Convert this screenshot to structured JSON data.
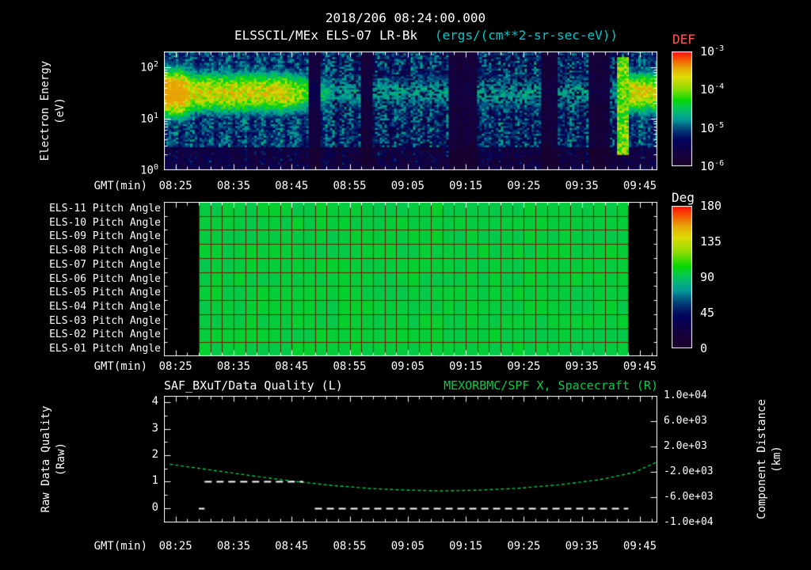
{
  "header": {
    "timestamp": "2018/206 08:24:00.000",
    "instrument": "ELSSCIL/MEx ELS-07 LR-Bk",
    "units": "(ergs/(cm**2-sr-sec-eV))"
  },
  "colors": {
    "background": "#000000",
    "text": "#ffffff",
    "units_text": "#00c8c8",
    "def_label": "#ff5555",
    "right_title": "#00cc44",
    "pitch_grid": "#6b1e00"
  },
  "time_axis": {
    "start": "08:23",
    "end": "09:48",
    "tick_interval_min": 10,
    "minor_tick_min": 2
  },
  "chart_data": [
    {
      "type": "heatmap",
      "role": "electron-energy-spectrogram",
      "title": "ELSSCIL/MEx ELS-07 LR-Bk",
      "units": "(ergs/(cm**2-sr-sec-eV))",
      "xlabel": "GMT(min)",
      "x_ticks": [
        "08:25",
        "08:35",
        "08:45",
        "08:55",
        "09:05",
        "09:15",
        "09:25",
        "09:35",
        "09:45"
      ],
      "ylabel_line1": "Electron Energy",
      "ylabel_line2": "(eV)",
      "y_scale": "log",
      "y_min_ev": 1,
      "y_max_ev": 200,
      "y_ticks": [
        "10^2",
        "10^1",
        "10^0"
      ],
      "colorbar": {
        "label": "DEF",
        "scale": "log",
        "ticks": [
          "10^-3",
          "10^-4",
          "10^-5",
          "10^-6"
        ]
      },
      "features": {
        "background_level": 0.3,
        "noise_amplitude": 0.22,
        "low_energy_cutoff_logE": 0.45,
        "main_band": {
          "center_logE": 1.5,
          "sigma_logE": 0.34,
          "peak": 0.8,
          "fade_start": "08:44",
          "fade_end": "08:52",
          "faint_level": 0.42
        },
        "hotspot": {
          "end": "08:26",
          "extra": 0.25,
          "center_logE": 1.45,
          "sigma_logE": 0.6
        },
        "dark_columns": [
          [
            "08:48",
            "08:50"
          ],
          [
            "08:57",
            "08:59"
          ],
          [
            "09:12",
            "09:17"
          ],
          [
            "09:28",
            "09:31"
          ],
          [
            "09:36",
            "09:40"
          ]
        ],
        "speckle_dark_start": "08:52",
        "speckle_dark_fraction": 0.2,
        "bright_column": {
          "start": "09:41",
          "end": "09:43",
          "level": 0.66,
          "logE_min": 0.3,
          "logE_max": 2.2
        },
        "right_band": {
          "start": "09:43",
          "peak": 0.8
        }
      }
    },
    {
      "type": "heatmap",
      "role": "pitch-angle-panel",
      "rows": [
        "ELS-11 Pitch Angle",
        "ELS-10 Pitch Angle",
        "ELS-09 Pitch Angle",
        "ELS-08 Pitch Angle",
        "ELS-07 Pitch Angle",
        "ELS-06 Pitch Angle",
        "ELS-05 Pitch Angle",
        "ELS-04 Pitch Angle",
        "ELS-03 Pitch Angle",
        "ELS-02 Pitch Angle",
        "ELS-01 Pitch Angle"
      ],
      "xlabel": "GMT(min)",
      "x_ticks": [
        "08:25",
        "08:35",
        "08:45",
        "08:55",
        "09:05",
        "09:15",
        "09:25",
        "09:35",
        "09:45"
      ],
      "data_start": "08:29",
      "data_end": "09:43",
      "uniform_value_deg": 95,
      "cell_minutes": 2,
      "colorbar": {
        "label": "Deg",
        "min": 0,
        "max": 180,
        "ticks": [
          "180",
          "135",
          "90",
          "45",
          "0"
        ]
      }
    },
    {
      "type": "line",
      "role": "quality-and-distance",
      "title_left": "SAF_BXuT/Data Quality (L)",
      "title_right": "MEXORBMC/SPF X, Spacecraft (R)",
      "xlabel": "GMT(min)",
      "x_ticks": [
        "08:25",
        "08:35",
        "08:45",
        "08:55",
        "09:05",
        "09:15",
        "09:25",
        "09:35",
        "09:45"
      ],
      "ylabel_left_line1": "Raw Data Quality",
      "ylabel_left_line2": "(Raw)",
      "ylabel_right_line1": "Component Distance",
      "ylabel_right_line2": "(km)",
      "y_left": {
        "min": -0.55,
        "max": 4.25,
        "ticks": [
          "4",
          "3",
          "2",
          "1",
          "0"
        ]
      },
      "y_right": {
        "min": -10000,
        "max": 10000,
        "ticks": [
          "1.0e+04",
          "6.0e+03",
          "2.0e+03",
          "-2.0e+03",
          "-6.0e+03",
          "-1.0e+04"
        ]
      },
      "series": [
        {
          "name": "spacecraft-x-component-distance",
          "axis": "right",
          "color": "#00cc44",
          "style": "dashed",
          "points": [
            [
              "08:24",
              -800
            ],
            [
              "08:31",
              -1700
            ],
            [
              "08:38",
              -2600
            ],
            [
              "08:45",
              -3450
            ],
            [
              "08:52",
              -4150
            ],
            [
              "08:59",
              -4650
            ],
            [
              "09:05",
              -4900
            ],
            [
              "09:11",
              -5000
            ],
            [
              "09:17",
              -4900
            ],
            [
              "09:24",
              -4600
            ],
            [
              "09:31",
              -4050
            ],
            [
              "09:38",
              -3250
            ],
            [
              "09:44",
              -2100
            ],
            [
              "09:48",
              -400
            ]
          ]
        },
        {
          "name": "raw-data-quality",
          "axis": "left",
          "color": "#ffffff",
          "style": "dashed",
          "segments": [
            {
              "value": 0,
              "start": "08:29",
              "end": "08:30"
            },
            {
              "value": 1,
              "start": "08:30",
              "end": "08:47"
            },
            {
              "value": 0,
              "start": "08:49",
              "end": "09:43"
            }
          ]
        }
      ]
    }
  ]
}
